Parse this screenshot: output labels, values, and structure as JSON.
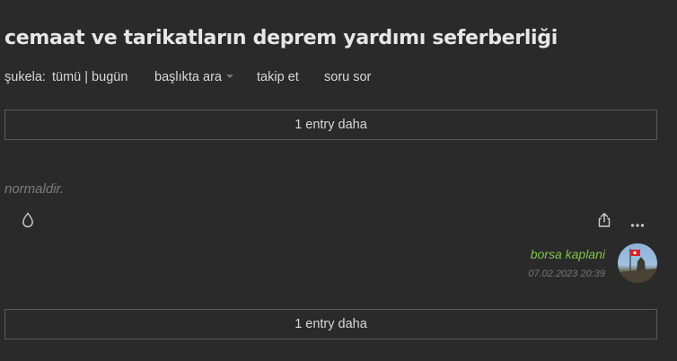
{
  "topic": {
    "title": "cemaat ve tarikatların deprem yardımı seferberliği"
  },
  "subnav": {
    "sukela_label": "şukela:",
    "sukela_value": "tümü | bugün",
    "search_label": "başlıkta ara",
    "follow_label": "takip et",
    "ask_label": "soru sor"
  },
  "more_entries_top": "1 entry daha",
  "entry": {
    "text": "normaldir.",
    "author": "borsa kaplani",
    "date": "07.02.2023 20:39"
  },
  "more_entries_bottom": "1 entry daha",
  "icons": {
    "favorite": "drop-icon",
    "share": "share-icon",
    "more": "ellipsis-icon"
  },
  "colors": {
    "background": "#2a2a2a",
    "author": "#81c14b",
    "muted": "#7d7d7d"
  }
}
